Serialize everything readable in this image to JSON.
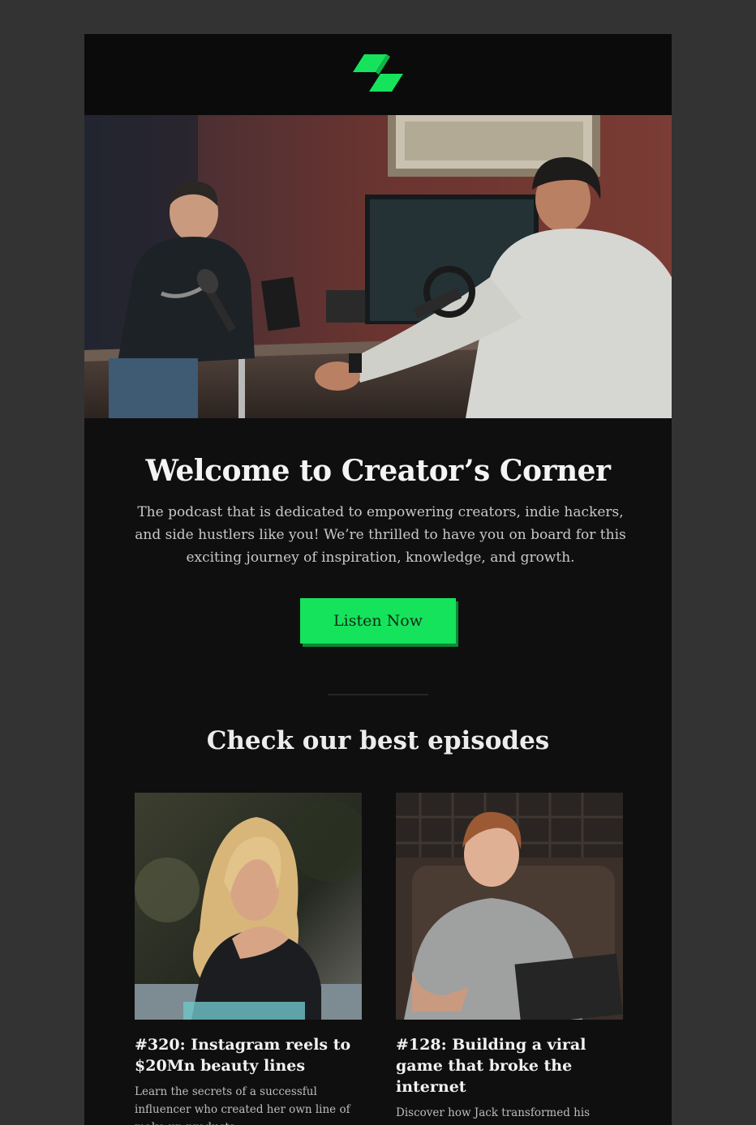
{
  "header": {
    "logo_icon": "green-parallelogram-logo-icon",
    "logo_color": "#16e35c"
  },
  "hero": {
    "image_subject": "two men recording a podcast at a desk with microphones"
  },
  "welcome": {
    "title": "Welcome to Creator’s Corner",
    "description": "The podcast that is dedicated to empowering creators, indie hackers, and side hustlers like you! We’re thrilled to have you on board for this exciting journey of inspiration, knowledge, and growth.",
    "button_label": "Listen Now",
    "button_color": "#16e35c"
  },
  "episodes_section": {
    "title": "Check our best episodes",
    "items": [
      {
        "title": "#320: Instagram reels to $20Mn beauty lines",
        "description": "Learn the secrets of a successful influencer who created her own line of make-up products"
      },
      {
        "title": "#128: Building a viral game that broke the internet",
        "description": "Discover how Jack transformed his creative hobbies into a successful side hustle"
      }
    ]
  },
  "colors": {
    "page_background": "#333333",
    "email_background": "#0f0f0f",
    "accent": "#16e35c"
  }
}
